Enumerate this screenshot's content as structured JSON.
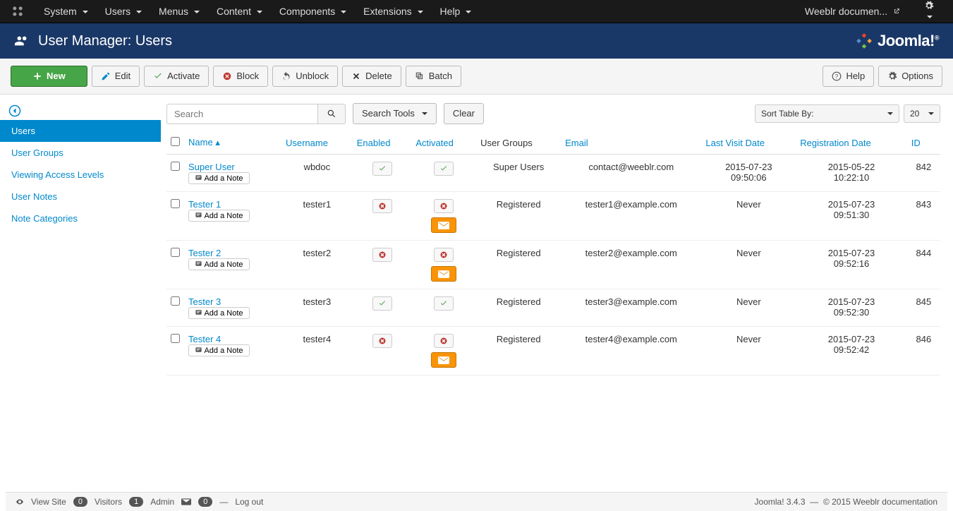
{
  "topbar": {
    "menus": [
      "System",
      "Users",
      "Menus",
      "Content",
      "Components",
      "Extensions",
      "Help"
    ],
    "site_link": "Weeblr documen..."
  },
  "header": {
    "title": "User Manager: Users",
    "logo_text": "Joomla!"
  },
  "toolbar": {
    "new": "New",
    "edit": "Edit",
    "activate": "Activate",
    "block": "Block",
    "unblock": "Unblock",
    "delete": "Delete",
    "batch": "Batch",
    "help": "Help",
    "options": "Options"
  },
  "sidebar": {
    "items": [
      "Users",
      "User Groups",
      "Viewing Access Levels",
      "User Notes",
      "Note Categories"
    ],
    "active_index": 0
  },
  "filter": {
    "search_placeholder": "Search",
    "search_tools": "Search Tools",
    "clear": "Clear",
    "sort_by": "Sort Table By:",
    "limit": "20"
  },
  "table": {
    "headers": {
      "name": "Name",
      "username": "Username",
      "enabled": "Enabled",
      "activated": "Activated",
      "groups": "User Groups",
      "email": "Email",
      "last_visit": "Last Visit Date",
      "registration": "Registration Date",
      "id": "ID"
    },
    "add_note": "Add a Note",
    "rows": [
      {
        "name": "Super User",
        "username": "wbdoc",
        "enabled": true,
        "activated": true,
        "show_mail": false,
        "groups": "Super Users",
        "email": "contact@weeblr.com",
        "last_visit": "2015-07-23 09:50:06",
        "registration": "2015-05-22 10:22:10",
        "id": "842"
      },
      {
        "name": "Tester 1",
        "username": "tester1",
        "enabled": false,
        "activated": false,
        "show_mail": true,
        "groups": "Registered",
        "email": "tester1@example.com",
        "last_visit": "Never",
        "registration": "2015-07-23 09:51:30",
        "id": "843"
      },
      {
        "name": "Tester 2",
        "username": "tester2",
        "enabled": false,
        "activated": false,
        "show_mail": true,
        "groups": "Registered",
        "email": "tester2@example.com",
        "last_visit": "Never",
        "registration": "2015-07-23 09:52:16",
        "id": "844"
      },
      {
        "name": "Tester 3",
        "username": "tester3",
        "enabled": true,
        "activated": true,
        "show_mail": false,
        "groups": "Registered",
        "email": "tester3@example.com",
        "last_visit": "Never",
        "registration": "2015-07-23 09:52:30",
        "id": "845"
      },
      {
        "name": "Tester 4",
        "username": "tester4",
        "enabled": false,
        "activated": false,
        "show_mail": true,
        "groups": "Registered",
        "email": "tester4@example.com",
        "last_visit": "Never",
        "registration": "2015-07-23 09:52:42",
        "id": "846"
      }
    ]
  },
  "footer": {
    "view_site": "View Site",
    "visitors_count": "0",
    "visitors_label": "Visitors",
    "admin_count": "1",
    "admin_label": "Admin",
    "msg_count": "0",
    "logout": "Log out",
    "version": "Joomla! 3.4.3",
    "copyright": "© 2015 Weeblr documentation"
  }
}
